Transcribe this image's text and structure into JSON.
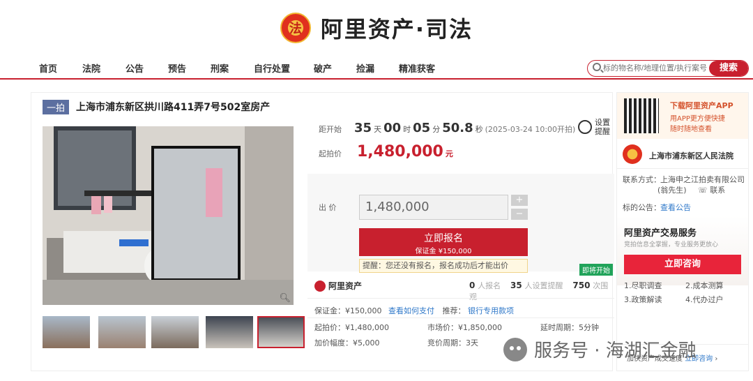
{
  "brand": {
    "name": "阿里资产·司法",
    "emblem": "法"
  },
  "nav": [
    "首页",
    "法院",
    "公告",
    "预告",
    "刑案",
    "自行处置",
    "破产",
    "捡漏",
    "精准获客"
  ],
  "search": {
    "placeholder": "标的物名称/地理位置/执行案号",
    "button": "搜索"
  },
  "item": {
    "tag": "一拍",
    "title": "上海市浦东新区拱川路411弄7号502室房产"
  },
  "countdown": {
    "label": "距开始",
    "days": "35",
    "days_unit": "天",
    "hours": "00",
    "hours_unit": "时",
    "minutes": "05",
    "minutes_unit": "分",
    "seconds": "50.8",
    "seconds_unit": "秒",
    "start": "(2025-03-24 10:00开拍)"
  },
  "reminder": {
    "line1": "设置",
    "line2": "提醒"
  },
  "start_price": {
    "label": "起拍价",
    "value": "1,480,000",
    "unit": "元"
  },
  "bid": {
    "label": "出 价",
    "value": "1,480,000",
    "plus": "+",
    "minus": "−",
    "badge": "即将开始",
    "button": "立即报名",
    "deposit": "保证金 ¥150,000",
    "warning": "提醒：您还没有报名，报名成功后才能出价"
  },
  "stats": {
    "platform": "阿里资产",
    "signed": "0",
    "signed_label": "人报名",
    "reminders": "35",
    "reminders_label": "人设置提醒",
    "views": "750",
    "views_label": "次围观"
  },
  "details": {
    "deposit": "保证金：¥150,000",
    "deposit_link": "查看如何支付",
    "recommend": "推荐：",
    "recommend_link": "银行专用款项",
    "start": "起拍价：¥1,480,000",
    "market": "市场价：¥1,850,000",
    "delay": "延时周期：5分钟",
    "increment": "加价幅度：¥5,000",
    "cycle": "竞价周期：3天"
  },
  "sidebar": {
    "app_title": "下载阿里资产APP",
    "app_desc1": "用APP更方便快捷",
    "app_desc2": "随时随地查看",
    "court": "上海市浦东新区人民法院",
    "contact_label": "联系方式：",
    "contact_value": "上海申之江拍卖有限公司",
    "contact_person": "(翁先生)",
    "contact_link": "联系",
    "notice_label": "标的公告：",
    "notice_link": "查看公告",
    "service_title": "阿里资产交易服务",
    "service_desc": "竞拍信息全掌握，专业服务更放心",
    "consult": "立即咨询",
    "items": [
      "1.尽职调查",
      "2.成本测算",
      "3.政策解读",
      "4.代办过户"
    ],
    "footer": "加快资产成交速度",
    "footer_link": "立即咨询"
  },
  "watermark": "服务号 · 海湖汇金融"
}
